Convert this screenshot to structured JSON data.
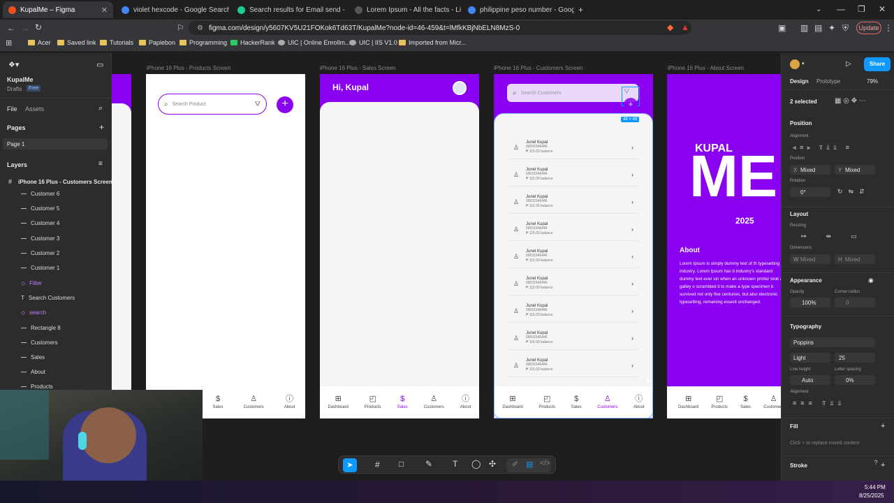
{
  "browser": {
    "tabs": [
      {
        "label": "KupalMe – Figma",
        "active": true,
        "color": "#f24e1e"
      },
      {
        "label": "violet hexcode - Google Search",
        "active": false,
        "color": "#4285f4"
      },
      {
        "label": "Search results for Email send - Flatic",
        "active": false,
        "color": "#1bcc8d"
      },
      {
        "label": "Lorem Ipsum - All the facts - Lipsum",
        "active": false,
        "color": "#555555"
      },
      {
        "label": "philippine peso number - Google Se",
        "active": false,
        "color": "#4285f4"
      }
    ],
    "url": "figma.com/design/y5607KV5U21FOKok6Td63T/KupalMe?node-id=46-459&t=lMfkKBjNbELN8MzS-0",
    "update_label": "Update",
    "bookmarks": [
      "Acer",
      "Saved link",
      "Tutorials",
      "Papiebon",
      "Programming",
      "HackerRank",
      "UIC | Online Enrollm...",
      "UIC | IIS V1.0",
      "Imported from Micr..."
    ]
  },
  "figma_left": {
    "file_name": "KupalMe",
    "drafts": "Drafts",
    "plan": "Free",
    "tab_file": "File",
    "tab_assets": "Assets",
    "pages_label": "Pages",
    "page1": "Page 1",
    "layers_label": "Layers",
    "root_layer": "iPhone 16 Plus - Customers Screen",
    "layers": [
      "Customer 6",
      "Customer 5",
      "Customer 4",
      "Customer 3",
      "Customer 2",
      "Customer 1",
      "Filter",
      "Search Customers",
      "search",
      "Rectangle 8",
      "Customers",
      "Sales",
      "About",
      "Products"
    ]
  },
  "canvas": {
    "frames": [
      {
        "title": "iPhone 16 Plus - Products Screen",
        "search_placeholder": "Search Product"
      },
      {
        "title": "iPhone 16 Plus - Sales Screen",
        "greeting": "Hi, Kupal"
      },
      {
        "title": "iPhone 16 Plus - Customers Screen",
        "search_placeholder": "Search Customers",
        "size_badge": "48 × 48"
      },
      {
        "title": "iPhone 16 Plus - About Screen",
        "brand_top": "KUPAL",
        "brand_big": "ME",
        "year": "2025",
        "about_heading": "About",
        "about_text": "Lorem Ipsum is simply dummy text of th typesetting industry. Lorem Ipsum has b industry's standard dummy text ever sin when an unknown printer took a galley o scrambled it to make a type specimen b survived not only five centuries, but also electronic typesetting, remaining essent unchanged."
      }
    ],
    "customer": {
      "name": "Junel Kupal",
      "phone": "09031546446",
      "balance": "₱ 115.00 balance"
    },
    "nav": [
      "Dashboard",
      "Products",
      "Sales",
      "Customers",
      "About"
    ]
  },
  "figma_right": {
    "tab_design": "Design",
    "tab_prototype": "Prototype",
    "zoom": "79%",
    "share": "Share",
    "selected": "2 selected",
    "position_h": "Position",
    "alignment": "Alignment",
    "position_s": "Position",
    "x_label": "X",
    "x_val": "Mixed",
    "y_label": "Y",
    "y_val": "Mixed",
    "rotation": "Rotation",
    "rotation_val": "0°",
    "layout_h": "Layout",
    "resizing": "Resizing",
    "dimensions": "Dimensions",
    "w_label": "W",
    "w_val": "Mixed",
    "h_label": "H",
    "h_val": "Mixed",
    "appearance_h": "Appearance",
    "opacity_label": "Opacity",
    "opacity_val": "100%",
    "radius_label": "Corner radius",
    "radius_val": "0",
    "typography_h": "Typography",
    "font": "Poppins",
    "weight": "Light",
    "size": "25",
    "line_height_label": "Line height",
    "line_height_val": "Auto",
    "letter_spacing_label": "Letter spacing",
    "letter_spacing_val": "0%",
    "align_label": "Alignment",
    "fill_h": "Fill",
    "fill_hint": "Click + to replace mixed content",
    "stroke_h": "Stroke"
  },
  "taskbar": {
    "time": "5:44 PM",
    "date": "8/25/2025"
  },
  "colors": {
    "accent": "#8a00f0",
    "figma_blue": "#0d99ff"
  }
}
